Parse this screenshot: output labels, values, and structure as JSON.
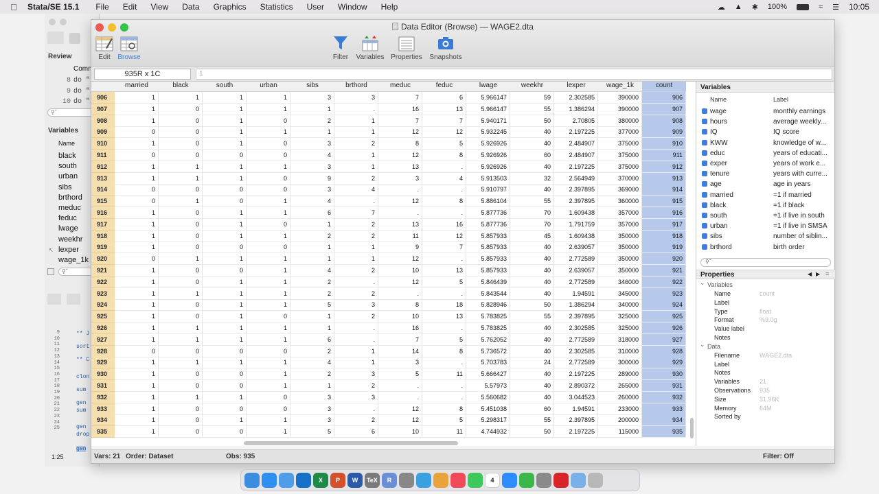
{
  "menubar": {
    "app": "Stata/SE 15.1",
    "items": [
      "File",
      "Edit",
      "View",
      "Data",
      "Graphics",
      "Statistics",
      "User",
      "Window",
      "Help"
    ],
    "battery": "100%",
    "time": "10:05"
  },
  "background_window": {
    "review_label": "Review",
    "command_col": "Comm",
    "review_rows": [
      {
        "num": "8",
        "cmd": "do \"/"
      },
      {
        "num": "9",
        "cmd": "do \"/"
      },
      {
        "num": "10",
        "cmd": "do \"/"
      }
    ],
    "variables_label": "Variables",
    "name_col": "Name",
    "var_list": [
      "black",
      "south",
      "urban",
      "sibs",
      "brthord",
      "meduc",
      "feduc",
      "lwage",
      "weekhr",
      "lexper",
      "wage_1k"
    ],
    "do_lines": [
      "9",
      "10",
      "11",
      "12",
      "13",
      "14",
      "15",
      "16",
      "17",
      "18",
      "19",
      "20",
      "21",
      "22",
      "23",
      "24",
      "25"
    ],
    "do_code": [
      "** J",
      "sort",
      "** C",
      "clon",
      "sum",
      "gen",
      "sum",
      "gen",
      "drop",
      "gen"
    ],
    "cursor_pos": "1:25"
  },
  "window": {
    "title": "Data Editor (Browse) — WAGE2.dta",
    "toolbar": {
      "edit": "Edit",
      "browse": "Browse",
      "filter": "Filter",
      "variables": "Variables",
      "properties": "Properties",
      "snapshots": "Snapshots"
    },
    "cell_ref": "935R x 1C",
    "cell_value": "1"
  },
  "grid": {
    "columns": [
      "married",
      "black",
      "south",
      "urban",
      "sibs",
      "brthord",
      "meduc",
      "feduc",
      "lwage",
      "weekhr",
      "lexper",
      "wage_1k",
      "count"
    ],
    "rows": [
      [
        "906",
        "1",
        "1",
        "1",
        "1",
        "3",
        "3",
        "7",
        "6",
        "5.966147",
        "59",
        "2.302585",
        "390000",
        "906"
      ],
      [
        "907",
        "1",
        "0",
        "1",
        "1",
        "1",
        ".",
        "16",
        "13",
        "5.966147",
        "55",
        "1.386294",
        "390000",
        "907"
      ],
      [
        "908",
        "1",
        "0",
        "1",
        "0",
        "2",
        "1",
        "7",
        "7",
        "5.940171",
        "50",
        "2.70805",
        "380000",
        "908"
      ],
      [
        "909",
        "0",
        "0",
        "1",
        "1",
        "1",
        "1",
        "12",
        "12",
        "5.932245",
        "40",
        "2.197225",
        "377000",
        "909"
      ],
      [
        "910",
        "1",
        "0",
        "1",
        "0",
        "3",
        "2",
        "8",
        "5",
        "5.926926",
        "40",
        "2.484907",
        "375000",
        "910"
      ],
      [
        "911",
        "0",
        "0",
        "0",
        "0",
        "4",
        "1",
        "12",
        "8",
        "5.926926",
        "60",
        "2.484907",
        "375000",
        "911"
      ],
      [
        "912",
        "1",
        "1",
        "1",
        "1",
        "3",
        "1",
        "13",
        ".",
        "5.926926",
        "40",
        "2.197225",
        "375000",
        "912"
      ],
      [
        "913",
        "1",
        "1",
        "1",
        "0",
        "9",
        "2",
        "3",
        "4",
        "5.913503",
        "32",
        "2.564949",
        "370000",
        "913"
      ],
      [
        "914",
        "0",
        "0",
        "0",
        "0",
        "3",
        "4",
        ".",
        ".",
        "5.910797",
        "40",
        "2.397895",
        "369000",
        "914"
      ],
      [
        "915",
        "0",
        "1",
        "0",
        "1",
        "4",
        ".",
        "12",
        "8",
        "5.886104",
        "55",
        "2.397895",
        "360000",
        "915"
      ],
      [
        "916",
        "1",
        "0",
        "1",
        "1",
        "6",
        "7",
        ".",
        ".",
        "5.877736",
        "70",
        "1.609438",
        "357000",
        "916"
      ],
      [
        "917",
        "1",
        "0",
        "1",
        "0",
        "1",
        "2",
        "13",
        "16",
        "5.877736",
        "70",
        "1.791759",
        "357000",
        "917"
      ],
      [
        "918",
        "1",
        "0",
        "1",
        "1",
        "2",
        "2",
        "11",
        "12",
        "5.857933",
        "45",
        "1.609438",
        "350000",
        "918"
      ],
      [
        "919",
        "1",
        "0",
        "0",
        "0",
        "1",
        "1",
        "9",
        "7",
        "5.857933",
        "40",
        "2.639057",
        "350000",
        "919"
      ],
      [
        "920",
        "0",
        "1",
        "1",
        "1",
        "1",
        "1",
        "12",
        ".",
        "5.857933",
        "40",
        "2.772589",
        "350000",
        "920"
      ],
      [
        "921",
        "1",
        "0",
        "0",
        "1",
        "4",
        "2",
        "10",
        "13",
        "5.857933",
        "40",
        "2.639057",
        "350000",
        "921"
      ],
      [
        "922",
        "1",
        "0",
        "1",
        "1",
        "2",
        ".",
        "12",
        "5",
        "5.846439",
        "40",
        "2.772589",
        "346000",
        "922"
      ],
      [
        "923",
        "1",
        "1",
        "1",
        "1",
        "2",
        "2",
        ".",
        ".",
        "5.843544",
        "40",
        "1.94591",
        "345000",
        "923"
      ],
      [
        "924",
        "1",
        "0",
        "1",
        "1",
        "5",
        "3",
        "8",
        "18",
        "5.828946",
        "50",
        "1.386294",
        "340000",
        "924"
      ],
      [
        "925",
        "1",
        "0",
        "1",
        "0",
        "1",
        "2",
        "10",
        "13",
        "5.783825",
        "55",
        "2.397895",
        "325000",
        "925"
      ],
      [
        "926",
        "1",
        "1",
        "1",
        "1",
        "1",
        ".",
        "16",
        ".",
        "5.783825",
        "40",
        "2.302585",
        "325000",
        "926"
      ],
      [
        "927",
        "1",
        "1",
        "1",
        "1",
        "6",
        ".",
        "7",
        "5",
        "5.762052",
        "40",
        "2.772589",
        "318000",
        "927"
      ],
      [
        "928",
        "0",
        "0",
        "0",
        "0",
        "2",
        "1",
        "14",
        "8",
        "5.736572",
        "40",
        "2.302585",
        "310000",
        "928"
      ],
      [
        "929",
        "1",
        "1",
        "1",
        "1",
        "4",
        "1",
        "3",
        ".",
        "5.703783",
        "24",
        "2.772589",
        "300000",
        "929"
      ],
      [
        "930",
        "1",
        "0",
        "0",
        "1",
        "2",
        "3",
        "5",
        "11",
        "5.666427",
        "40",
        "2.197225",
        "289000",
        "930"
      ],
      [
        "931",
        "1",
        "0",
        "0",
        "1",
        "1",
        "2",
        ".",
        ".",
        "5.57973",
        "40",
        "2.890372",
        "265000",
        "931"
      ],
      [
        "932",
        "1",
        "1",
        "1",
        "0",
        "3",
        "3",
        ".",
        ".",
        "5.560682",
        "40",
        "3.044523",
        "260000",
        "932"
      ],
      [
        "933",
        "1",
        "0",
        "0",
        "0",
        "3",
        ".",
        "12",
        "8",
        "5.451038",
        "60",
        "1.94591",
        "233000",
        "933"
      ],
      [
        "934",
        "1",
        "0",
        "1",
        "1",
        "3",
        "2",
        "12",
        "5",
        "5.298317",
        "55",
        "2.397895",
        "200000",
        "934"
      ],
      [
        "935",
        "1",
        "0",
        "0",
        "1",
        "5",
        "6",
        "10",
        "11",
        "4.744932",
        "50",
        "2.197225",
        "115000",
        "935"
      ]
    ]
  },
  "status": {
    "vars": "Vars: 21",
    "order": "Order: Dataset",
    "obs": "Obs: 935",
    "filter": "Filter: Off"
  },
  "variables_panel": {
    "title": "Variables",
    "name_col": "Name",
    "label_col": "Label",
    "items": [
      {
        "name": "wage",
        "label": "monthly earnings"
      },
      {
        "name": "hours",
        "label": "average weekly..."
      },
      {
        "name": "IQ",
        "label": "IQ score"
      },
      {
        "name": "KWW",
        "label": "knowledge of w..."
      },
      {
        "name": "educ",
        "label": "years of educati..."
      },
      {
        "name": "exper",
        "label": "years of work e..."
      },
      {
        "name": "tenure",
        "label": "years with curre..."
      },
      {
        "name": "age",
        "label": "age in years"
      },
      {
        "name": "married",
        "label": "=1 if married"
      },
      {
        "name": "black",
        "label": "=1 if black"
      },
      {
        "name": "south",
        "label": "=1 if live in south"
      },
      {
        "name": "urban",
        "label": "=1 if live in SMSA"
      },
      {
        "name": "sibs",
        "label": "number of siblin..."
      },
      {
        "name": "brthord",
        "label": "birth order"
      }
    ]
  },
  "properties_panel": {
    "title": "Properties",
    "variables_section": "Variables",
    "var_props": [
      {
        "k": "Name",
        "v": "count"
      },
      {
        "k": "Label",
        "v": ""
      },
      {
        "k": "Type",
        "v": "float"
      },
      {
        "k": "Format",
        "v": "%9.0g"
      },
      {
        "k": "Value label",
        "v": ""
      },
      {
        "k": "Notes",
        "v": ""
      }
    ],
    "data_section": "Data",
    "data_props": [
      {
        "k": "Filename",
        "v": "WAGE2.dta"
      },
      {
        "k": "Label",
        "v": ""
      },
      {
        "k": "Notes",
        "v": ""
      },
      {
        "k": "Variables",
        "v": "21"
      },
      {
        "k": "Observations",
        "v": "935"
      },
      {
        "k": "Size",
        "v": "31.96K"
      },
      {
        "k": "Memory",
        "v": "64M"
      },
      {
        "k": "Sorted by",
        "v": ""
      }
    ]
  },
  "dock": {
    "icons": [
      "finder-icon",
      "safari-icon",
      "mail-icon",
      "outlook-icon",
      "excel-icon",
      "powerpoint-icon",
      "word-icon",
      "tex-icon",
      "r-icon",
      "launchpad-icon",
      "telegram-icon",
      "photos-icon",
      "music-icon",
      "messages-icon",
      "calendar-icon",
      "zoom-icon",
      "facetime-icon",
      "settings-icon",
      "acrobat-icon",
      "folder-icon",
      "trash-icon"
    ],
    "calendar_day": "4"
  },
  "colors": {
    "row_header": "#f6dfae",
    "selected_column": "#b7c9ea",
    "accent": "#3f7ddd"
  }
}
